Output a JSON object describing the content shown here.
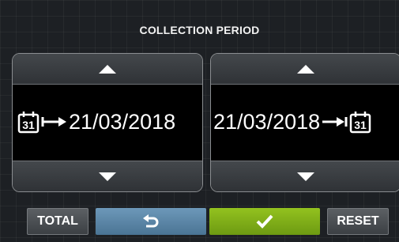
{
  "header": {
    "title": "COLLECTION PERIOD"
  },
  "period": {
    "start_date": "21/03/2018",
    "end_date": "21/03/2018",
    "calendar_day": "31"
  },
  "icons": {
    "start": "calendar-icon",
    "end": "calendar-icon",
    "up": "triangle-up-icon",
    "down": "triangle-down-icon",
    "back": "undo-arrow-icon",
    "confirm": "check-icon"
  },
  "footer": {
    "total_label": "TOTAL",
    "reset_label": "RESET"
  },
  "colors": {
    "back_button": "#5a86a8",
    "confirm_button": "#84b31a",
    "background": "#1d2024"
  }
}
